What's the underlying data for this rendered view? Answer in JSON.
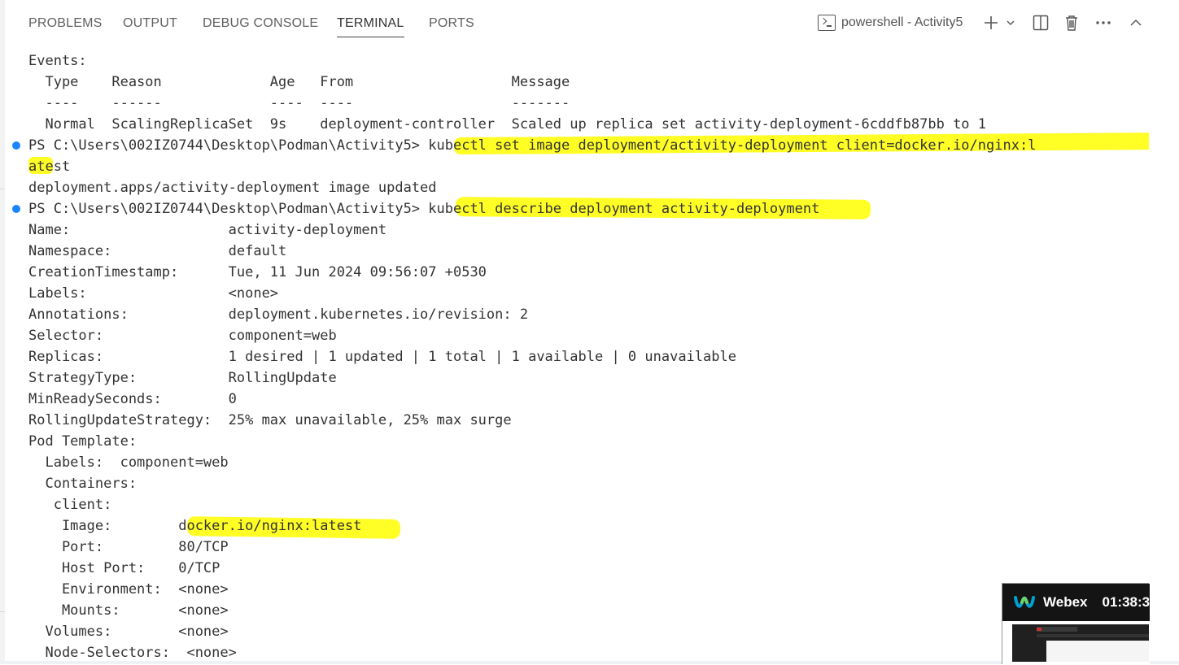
{
  "tabs": [
    {
      "label": "PROBLEMS"
    },
    {
      "label": "OUTPUT"
    },
    {
      "label": "DEBUG CONSOLE"
    },
    {
      "label": "TERMINAL",
      "active": true
    },
    {
      "label": "PORTS"
    }
  ],
  "terminal_selector": {
    "label": "powershell - Activity5",
    "icon": "terminal-icon"
  },
  "toolbar_icons": [
    "plus-icon",
    "chevron-down-icon",
    "split-icon",
    "trash-icon",
    "more-icon",
    "chevron-up-icon"
  ],
  "colors": {
    "highlight": "#ffff00",
    "prompt_dot": "#1a85ff",
    "text": "#333333"
  },
  "terminal": {
    "lines": [
      {
        "text": "Events:"
      },
      {
        "text": "  Type    Reason             Age   From                   Message"
      },
      {
        "text": "  ----    ------             ----  ----                   -------"
      },
      {
        "text": "  Normal  ScalingReplicaSet  9s    deployment-controller  Scaled up replica set activity-deployment-6cddfb87bb to 1"
      },
      {
        "text": "PS C:\\Users\\002IZ0744\\Desktop\\Podman\\Activity5> kubectl set image deployment/activity-deployment client=docker.io/nginx:l",
        "prompt": true
      },
      {
        "text": "atest"
      },
      {
        "text": "deployment.apps/activity-deployment image updated"
      },
      {
        "text": "PS C:\\Users\\002IZ0744\\Desktop\\Podman\\Activity5> kubectl describe deployment activity-deployment",
        "prompt": true
      },
      {
        "text": "Name:                   activity-deployment"
      },
      {
        "text": "Namespace:              default"
      },
      {
        "text": "CreationTimestamp:      Tue, 11 Jun 2024 09:56:07 +0530"
      },
      {
        "text": "Labels:                 <none>"
      },
      {
        "text": "Annotations:            deployment.kubernetes.io/revision: 2"
      },
      {
        "text": "Selector:               component=web"
      },
      {
        "text": "Replicas:               1 desired | 1 updated | 1 total | 1 available | 0 unavailable"
      },
      {
        "text": "StrategyType:           RollingUpdate"
      },
      {
        "text": "MinReadySeconds:        0"
      },
      {
        "text": "RollingUpdateStrategy:  25% max unavailable, 25% max surge"
      },
      {
        "text": "Pod Template:"
      },
      {
        "text": "  Labels:  component=web"
      },
      {
        "text": "  Containers:"
      },
      {
        "text": "   client:"
      },
      {
        "text": "    Image:        docker.io/nginx:latest"
      },
      {
        "text": "    Port:         80/TCP"
      },
      {
        "text": "    Host Port:    0/TCP"
      },
      {
        "text": "    Environment:  <none>"
      },
      {
        "text": "    Mounts:       <none>"
      },
      {
        "text": "  Volumes:        <none>"
      },
      {
        "text": "  Node-Selectors:  <none>"
      }
    ]
  },
  "webex": {
    "name": "Webex",
    "time": "01:38:3"
  }
}
